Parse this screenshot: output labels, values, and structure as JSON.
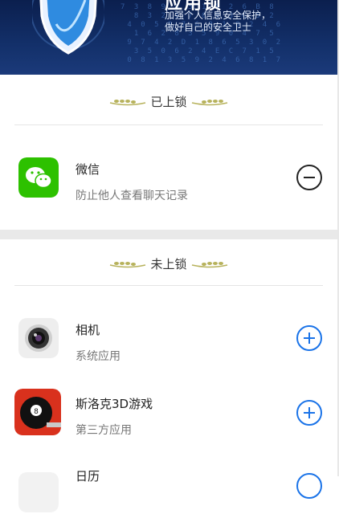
{
  "banner": {
    "title": "应用锁",
    "slogan_line1": "加强个人信息安全保护，",
    "slogan_line2": "做好自己的安全卫士"
  },
  "locked_section": {
    "header": "已上锁",
    "apps": [
      {
        "name": "微信",
        "desc": "防止他人查看聊天记录",
        "icon": "wechat-icon",
        "action_icon": "minus-circle-icon"
      }
    ]
  },
  "unlocked_section": {
    "header": "未上锁",
    "apps": [
      {
        "name": "相机",
        "desc": "系统应用",
        "icon": "camera-icon",
        "action_icon": "plus-circle-icon"
      },
      {
        "name": "斯洛克3D游戏",
        "desc": "第三方应用",
        "icon": "billiard-ball-icon",
        "action_icon": "plus-circle-icon"
      },
      {
        "name": "日历",
        "desc": "",
        "icon": "calendar-icon",
        "action_icon": "plus-circle-icon"
      }
    ]
  },
  "colors": {
    "accent": "#1a73e8",
    "wechat_green": "#2dc100",
    "wheat": "#b7b25c"
  }
}
